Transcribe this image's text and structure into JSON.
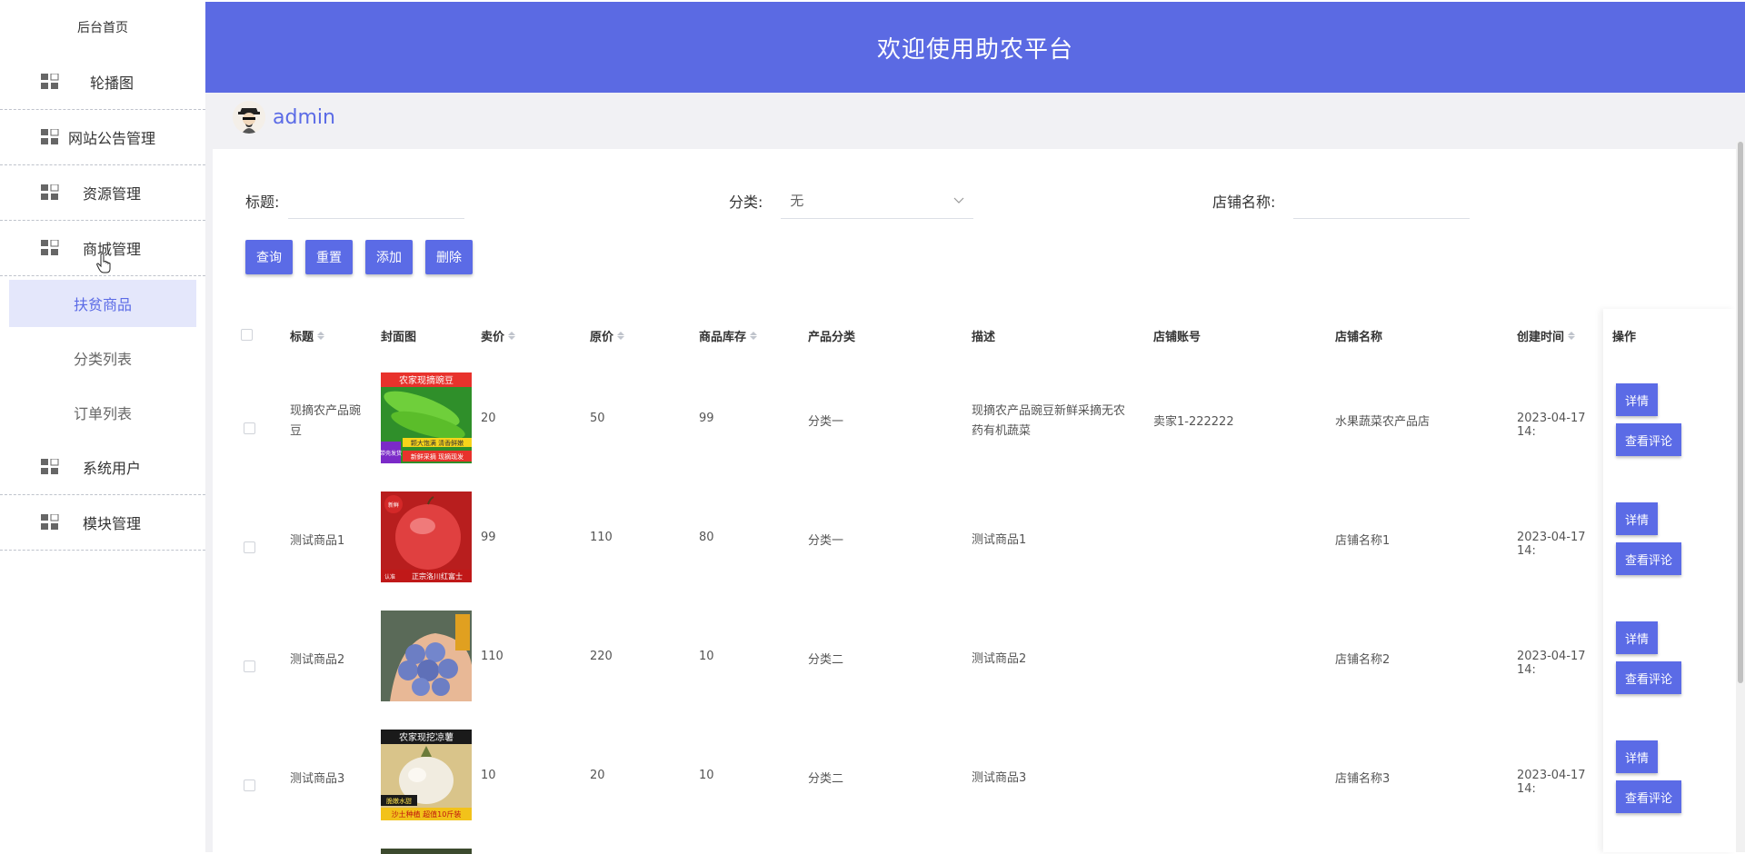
{
  "sidebar": {
    "home": "后台首页",
    "items": [
      {
        "label": "轮播图"
      },
      {
        "label": "网站公告管理"
      },
      {
        "label": "资源管理"
      },
      {
        "label": "商城管理"
      }
    ],
    "sub_items": [
      {
        "label": "扶贫商品",
        "active": true
      },
      {
        "label": "分类列表"
      },
      {
        "label": "订单列表"
      }
    ],
    "items2": [
      {
        "label": "系统用户"
      },
      {
        "label": "模块管理"
      }
    ]
  },
  "header": {
    "title": "欢迎使用助农平台"
  },
  "user": {
    "name": "admin"
  },
  "search": {
    "title_label": "标题:",
    "title_value": "",
    "category_label": "分类:",
    "category_value": "无",
    "store_label": "店铺名称:",
    "store_value": ""
  },
  "buttons": {
    "query": "查询",
    "reset": "重置",
    "add": "添加",
    "delete": "删除"
  },
  "table": {
    "columns": {
      "title": "标题",
      "cover": "封面图",
      "price": "卖价",
      "original": "原价",
      "stock": "商品库存",
      "category": "产品分类",
      "desc": "描述",
      "account": "店铺账号",
      "store": "店铺名称",
      "created": "创建时间",
      "ops": "操作"
    },
    "rows": [
      {
        "title": "现摘农产品豌豆",
        "price": "20",
        "original": "50",
        "stock": "99",
        "category": "分类一",
        "desc": "现摘农产品豌豆新鲜采摘无农药有机蔬菜",
        "account": "卖家1-222222",
        "store": "水果蔬菜农产品店",
        "created": "2023-04-17 14:",
        "cover": "peas-image"
      },
      {
        "title": "测试商品1",
        "price": "99",
        "original": "110",
        "stock": "80",
        "category": "分类一",
        "desc": "测试商品1",
        "account": "",
        "store": "店铺名称1",
        "created": "2023-04-17 14:",
        "cover": "apple-image"
      },
      {
        "title": "测试商品2",
        "price": "110",
        "original": "220",
        "stock": "10",
        "category": "分类二",
        "desc": "测试商品2",
        "account": "",
        "store": "店铺名称2",
        "created": "2023-04-17 14:",
        "cover": "blueberry-image"
      },
      {
        "title": "测试商品3",
        "price": "10",
        "original": "20",
        "stock": "10",
        "category": "分类二",
        "desc": "测试商品3",
        "account": "",
        "store": "店铺名称3",
        "created": "2023-04-17 14:",
        "cover": "jicama-image"
      }
    ],
    "op_detail": "详情",
    "op_comment": "查看评论"
  },
  "cover_texts": {
    "peas_banner": "农家现摘豌豆",
    "peas_tag1": "颗大饱满 清香鲜嫩",
    "peas_tag2": "新鲜采摘 现摘现发",
    "peas_corner": "带壳发货",
    "apple_badge": "新鲜",
    "apple_footer": "正宗洛川红富士",
    "apple_footer2": "认准",
    "jicama_banner": "农家现挖凉薯",
    "jicama_tag": "脆嫩水甜",
    "jicama_footer": "沙土种植 超值10斤装"
  },
  "colors": {
    "accent": "#5b6be6",
    "header": "#5b6ae3"
  }
}
